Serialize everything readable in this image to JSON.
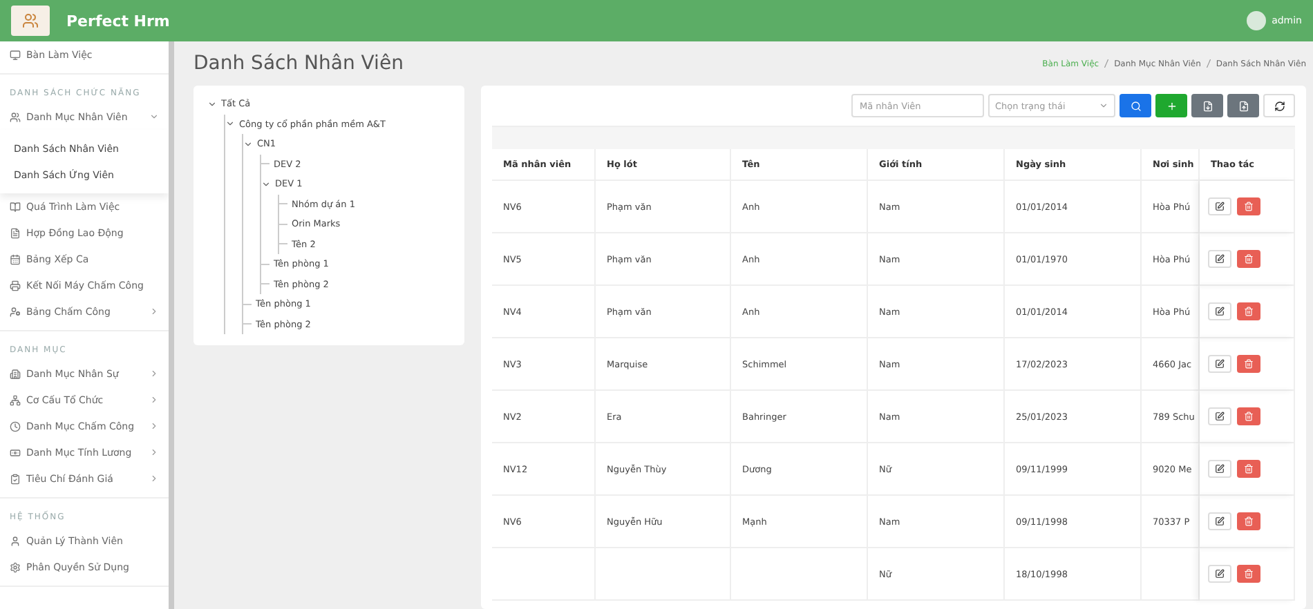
{
  "header": {
    "app_name": "Perfect Hrm",
    "user": "admin"
  },
  "sidebar": {
    "sections": [
      {
        "items": [
          {
            "label": "Bàn Làm Việc"
          }
        ]
      },
      {
        "title": "DANH SÁCH CHỨC NĂNG",
        "items": [
          {
            "label": "Danh Mục Nhân Viên",
            "expanded": true,
            "children": [
              {
                "label": "Danh Sách Nhân Viên"
              },
              {
                "label": "Danh Sách Ứng Viên"
              }
            ]
          },
          {
            "label": "Quá Trình Làm Việc"
          },
          {
            "label": "Hợp Đồng Lao Động"
          },
          {
            "label": "Bảng Xếp Ca"
          },
          {
            "label": "Kết Nối Máy Chấm Công"
          },
          {
            "label": "Bảng Chấm Công",
            "expanded": false
          }
        ]
      },
      {
        "title": "DANH MỤC",
        "items": [
          {
            "label": "Danh Mục Nhân Sự",
            "expanded": false
          },
          {
            "label": "Cơ Cấu Tổ Chức",
            "expanded": false
          },
          {
            "label": "Danh Mục Chấm Công",
            "expanded": false
          },
          {
            "label": "Danh Mục Tính Lương",
            "expanded": false
          },
          {
            "label": "Tiêu Chí Đánh Giá",
            "expanded": false
          }
        ]
      },
      {
        "title": "HỆ THỐNG",
        "items": [
          {
            "label": "Quản Lý Thành Viên"
          },
          {
            "label": "Phân Quyền Sử Dụng"
          }
        ]
      }
    ]
  },
  "page_title": "Danh Sách Nhân Viên",
  "breadcrumb": [
    "Bàn Làm Việc",
    "Danh Mục Nhân Viên",
    "Danh Sách Nhân Viên"
  ],
  "tree": [
    {
      "label": "Tất Cả",
      "expanded": true,
      "children": [
        {
          "label": "Công ty cổ phần phần mềm A&T",
          "expanded": true,
          "children": [
            {
              "label": "CN1",
              "expanded": true,
              "children": [
                {
                  "label": "DEV 2"
                },
                {
                  "label": "DEV 1",
                  "expanded": true,
                  "children": [
                    {
                      "label": "Nhóm dự án 1"
                    },
                    {
                      "label": "Orin Marks"
                    },
                    {
                      "label": "Tên 2"
                    }
                  ]
                },
                {
                  "label": "Tên phòng 1"
                },
                {
                  "label": "Tên phòng 2"
                }
              ]
            },
            {
              "label": "Tên phòng 1"
            },
            {
              "label": "Tên phòng 2"
            }
          ]
        }
      ]
    }
  ],
  "toolbar": {
    "search": {
      "placeholder": "Mã nhân Viên"
    },
    "status_select": {
      "placeholder": "Chọn trạng thái"
    }
  },
  "table": {
    "columns": [
      "Mã nhân viên",
      "Họ lót",
      "Tên",
      "Giới tính",
      "Ngày sinh",
      "Nơi sinh",
      "Thao tác"
    ],
    "rows": [
      {
        "code": "NV6",
        "ho_lot": "Phạm văn",
        "ten": "Anh",
        "gender": "Nam",
        "dob": "01/01/2014",
        "place": "Hòa Phú"
      },
      {
        "code": "NV5",
        "ho_lot": "Phạm văn",
        "ten": "Anh",
        "gender": "Nam",
        "dob": "01/01/1970",
        "place": "Hòa Phú"
      },
      {
        "code": "NV4",
        "ho_lot": "Phạm văn",
        "ten": "Anh",
        "gender": "Nam",
        "dob": "01/01/2014",
        "place": "Hòa Phú"
      },
      {
        "code": "NV3",
        "ho_lot": "Marquise",
        "ten": "Schimmel",
        "gender": "Nam",
        "dob": "17/02/2023",
        "place": "4660 Jac"
      },
      {
        "code": "NV2",
        "ho_lot": "Era",
        "ten": "Bahringer",
        "gender": "Nam",
        "dob": "25/01/2023",
        "place": "789 Schu"
      },
      {
        "code": "NV12",
        "ho_lot": "Nguyễn Thùy",
        "ten": "Dương",
        "gender": "Nữ",
        "dob": "09/11/1999",
        "place": "9020 Me"
      },
      {
        "code": "NV6",
        "ho_lot": "Nguyễn Hữu",
        "ten": "Mạnh",
        "gender": "Nam",
        "dob": "09/11/1998",
        "place": "70337 P"
      },
      {
        "gender": "Nữ",
        "dob": "18/10/1998"
      }
    ]
  }
}
